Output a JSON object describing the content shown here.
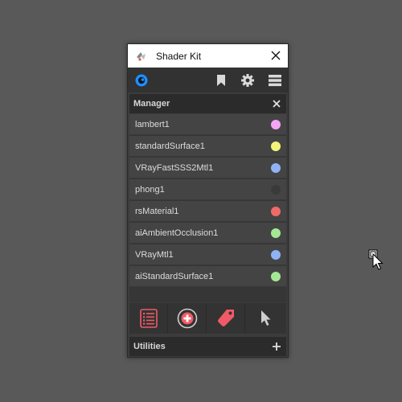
{
  "window": {
    "title": "Shader Kit"
  },
  "manager": {
    "header_label": "Manager",
    "materials": [
      {
        "name": "lambert1",
        "color": "#f4a5f4"
      },
      {
        "name": "standardSurface1",
        "color": "#f3f37a"
      },
      {
        "name": "VRayFastSSS2Mtl1",
        "color": "#8fb3f5"
      },
      {
        "name": "phong1",
        "color": "#3a3a3a"
      },
      {
        "name": "rsMaterial1",
        "color": "#f06a6a"
      },
      {
        "name": "aiAmbientOcclusion1",
        "color": "#a5e894"
      },
      {
        "name": "VRayMtl1",
        "color": "#8fb3f5"
      },
      {
        "name": "aiStandardSurface1",
        "color": "#a5e894"
      }
    ]
  },
  "utilities": {
    "header_label": "Utilities"
  },
  "icons": {
    "app": "shader-kit-logo-icon",
    "close": "close-icon",
    "toolbar": [
      "blue-circle-icon",
      "bookmark-icon",
      "gear-icon",
      "menu-icon"
    ],
    "bottom": [
      "list-icon",
      "add-circle-icon",
      "tag-icon",
      "cursor-arrow-icon"
    ]
  },
  "colors": {
    "accent_blue": "#1e90ff",
    "accent_red": "#f05a66"
  }
}
